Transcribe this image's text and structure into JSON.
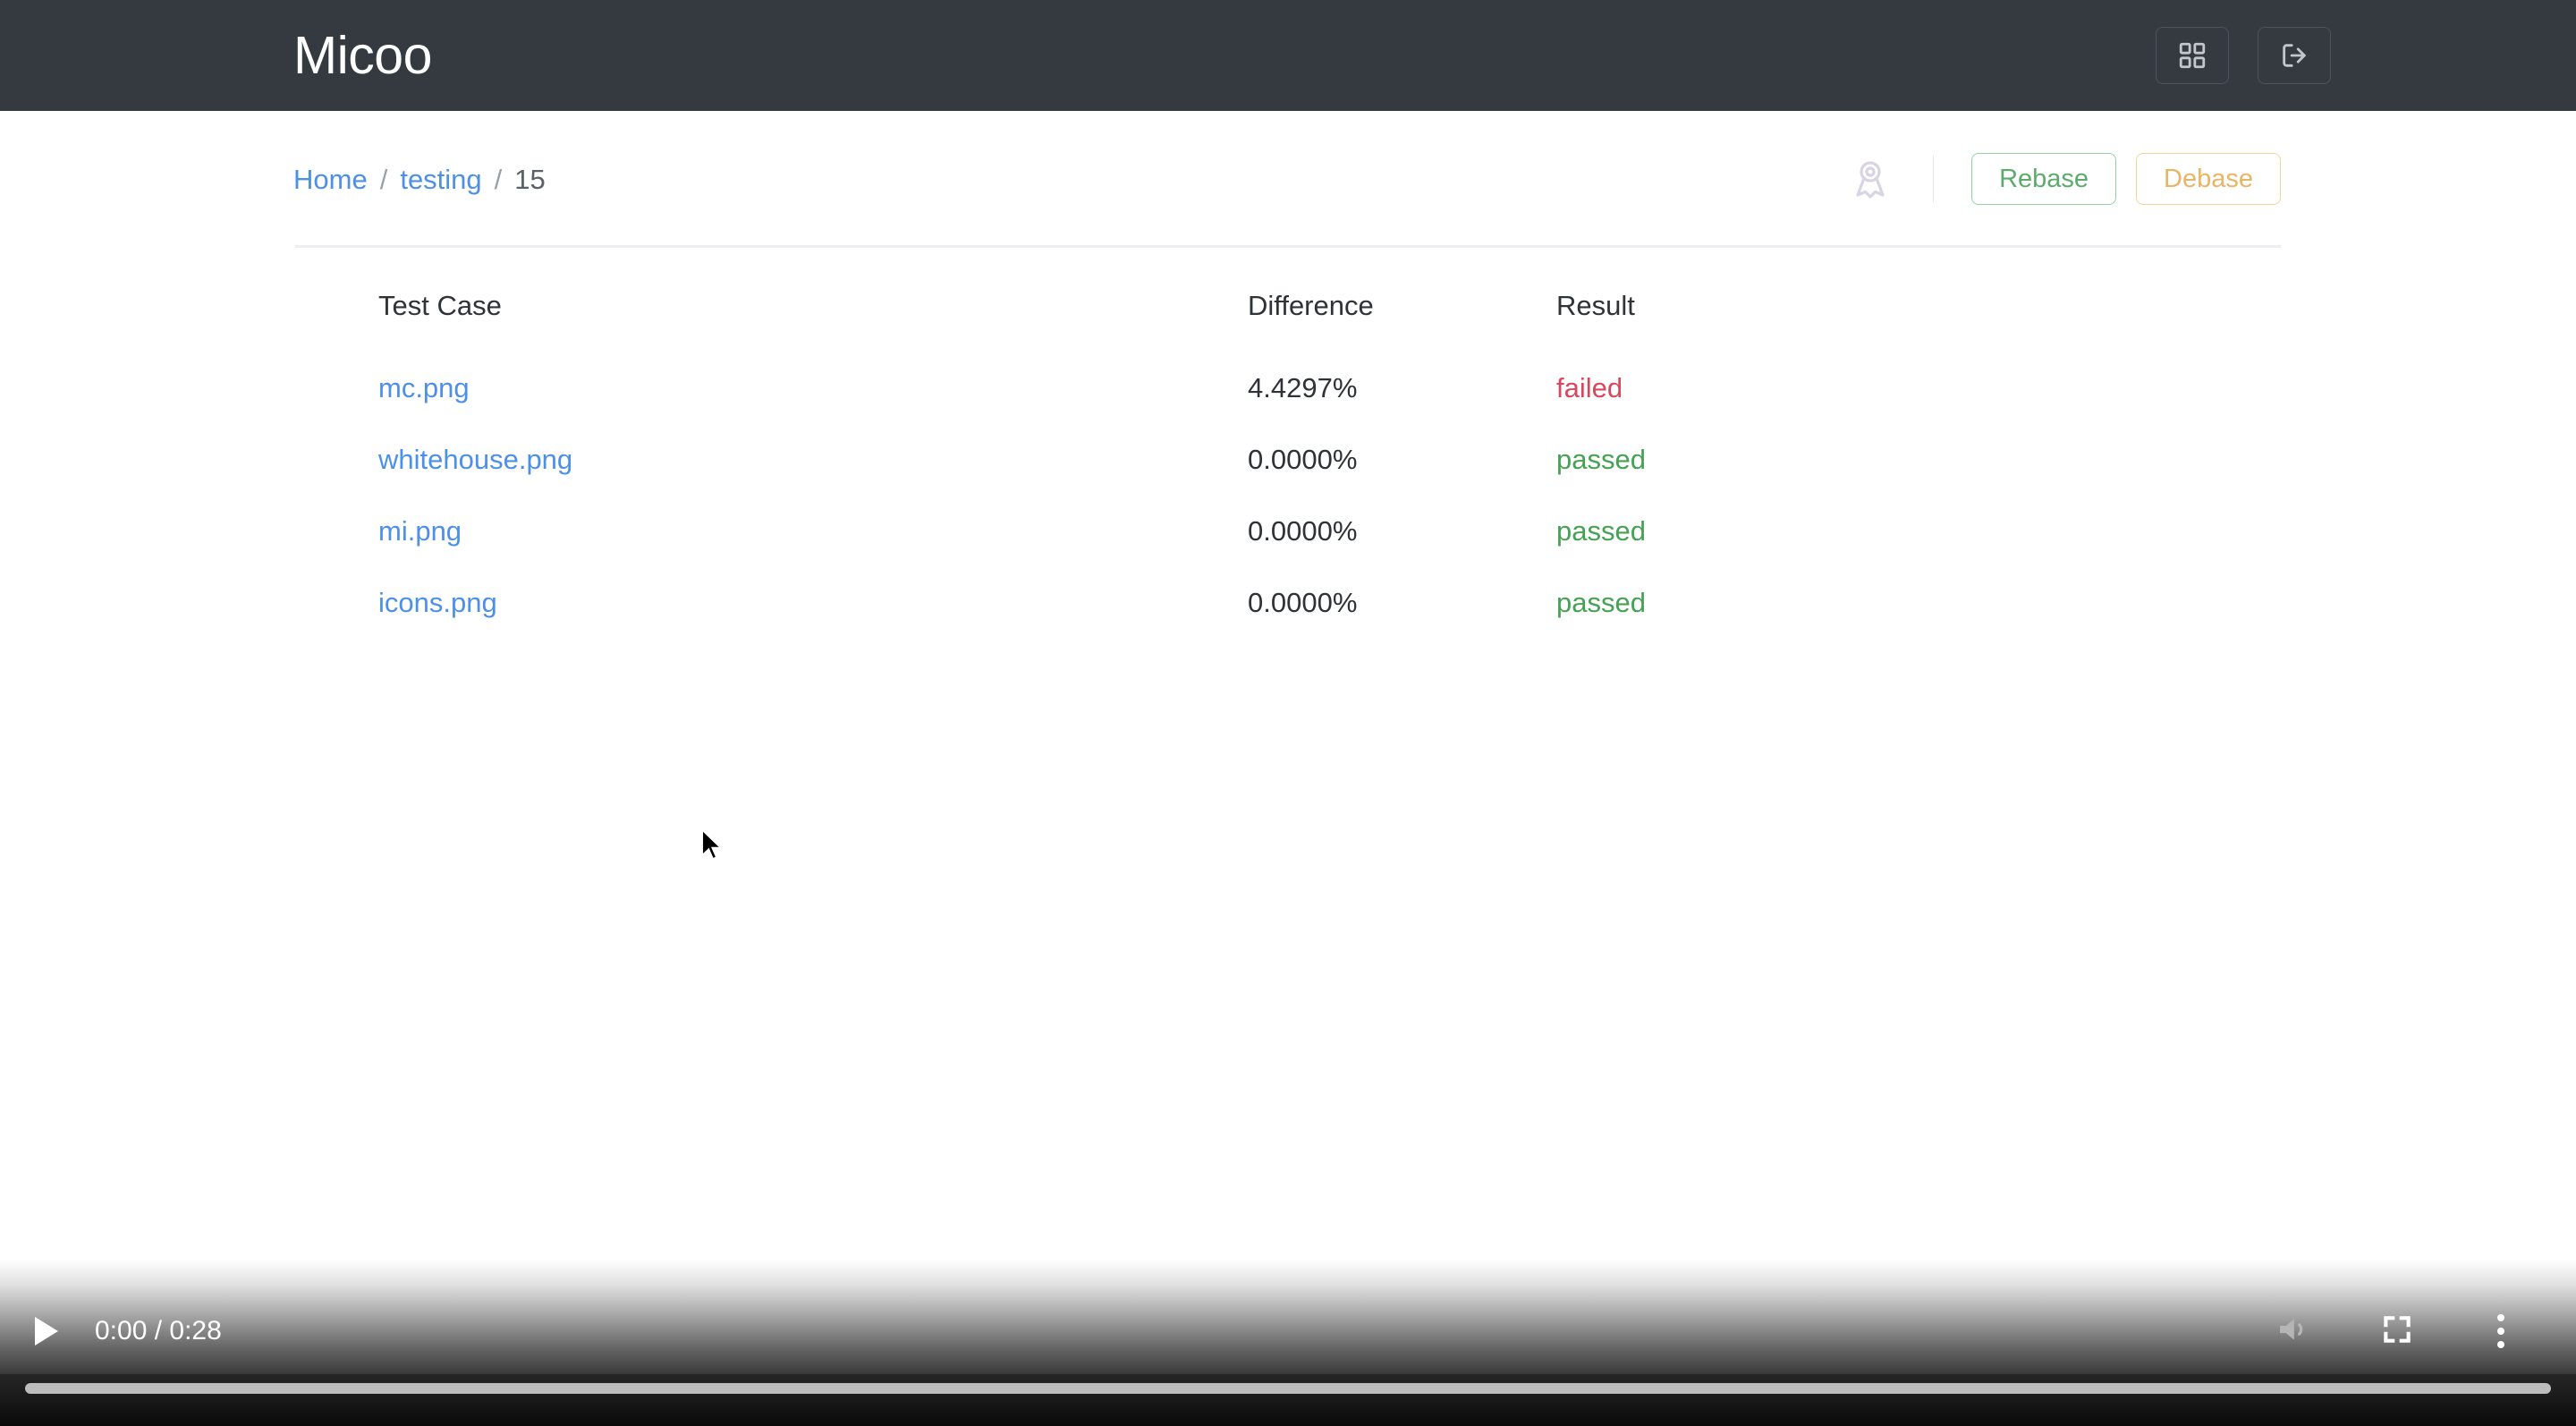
{
  "navbar": {
    "brand": "Micoo",
    "buttons": [
      {
        "name": "dashboard-grid-button",
        "icon": "grid-icon"
      },
      {
        "name": "logout-button",
        "icon": "logout-icon"
      }
    ]
  },
  "breadcrumb": {
    "items": [
      {
        "label": "Home",
        "link": true
      },
      {
        "label": "testing",
        "link": true
      },
      {
        "label": "15",
        "link": false
      }
    ],
    "separator": "/"
  },
  "actions": {
    "award_icon": "award-ribbon-icon",
    "rebase_label": "Rebase",
    "debase_label": "Debase"
  },
  "table": {
    "headers": {
      "test_case": "Test Case",
      "difference": "Difference",
      "result": "Result"
    },
    "rows": [
      {
        "test_case": "mc.png",
        "difference": "4.4297%",
        "result": "failed"
      },
      {
        "test_case": "whitehouse.png",
        "difference": "0.0000%",
        "result": "passed"
      },
      {
        "test_case": "mi.png",
        "difference": "0.0000%",
        "result": "passed"
      },
      {
        "test_case": "icons.png",
        "difference": "0.0000%",
        "result": "passed"
      }
    ]
  },
  "video": {
    "play_label": "play-icon",
    "time": "0:00 / 0:28",
    "current_time": "0:00",
    "duration": "0:28",
    "controls": [
      {
        "name": "volume-button",
        "icon": "volume-icon"
      },
      {
        "name": "fullscreen-button",
        "icon": "fullscreen-icon"
      },
      {
        "name": "more-options-button",
        "icon": "kebab-menu-icon"
      }
    ],
    "progress_percent": 0
  },
  "colors": {
    "navbar_bg": "#343a40",
    "link": "#4d90e8",
    "failed": "#d9465e",
    "passed": "#47a155",
    "rebase_border": "#93d3a2",
    "rebase_text": "#5cab6c",
    "debase_border": "#f3d19b",
    "debase_text": "#e9b463",
    "award_icon": "#d8d4e4",
    "divider": "#eceef2"
  }
}
